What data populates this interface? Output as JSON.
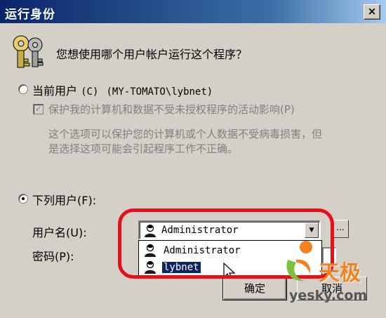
{
  "window": {
    "title": "运行身份",
    "close_glyph": "×"
  },
  "prompt": "您想使用哪个用户帐户运行这个程序？",
  "current_user": {
    "radio_label": "当前用户",
    "accesskey": "(C)",
    "account": "(MY-TOMATO\\lybnet)",
    "protect_checkbox_label": "保护我的计算机和数据不受未授权程序的活动影响(P)",
    "description_line1": "这个选项可以保护您的计算机或个人数据不受病毒损害，但",
    "description_line2": "是选择这项可能会引起程序工作不正确。"
  },
  "following_user": {
    "radio_label": "下列用户(F):",
    "username_label": "用户名(U):",
    "password_label": "密码(P):",
    "username_value": "Administrator",
    "browse_label": "...",
    "dropdown_options": [
      "Administrator",
      "lybnet"
    ],
    "dropdown_highlighted": "lybnet"
  },
  "buttons": {
    "ok": "确定",
    "cancel": "取消"
  },
  "watermark": {
    "brand": "天极",
    "domain": "yesky.com"
  },
  "colors": {
    "titlebar": "#0a246a",
    "face": "#d4d0c8",
    "highlight": "#0a246a",
    "annotation": "#e5101a",
    "watermark_orange": "#f5821f",
    "watermark_green": "#7cc242"
  },
  "icons": [
    "keys-icon",
    "user-icon",
    "dropdown-arrow-icon",
    "cursor-arrow-icon"
  ]
}
